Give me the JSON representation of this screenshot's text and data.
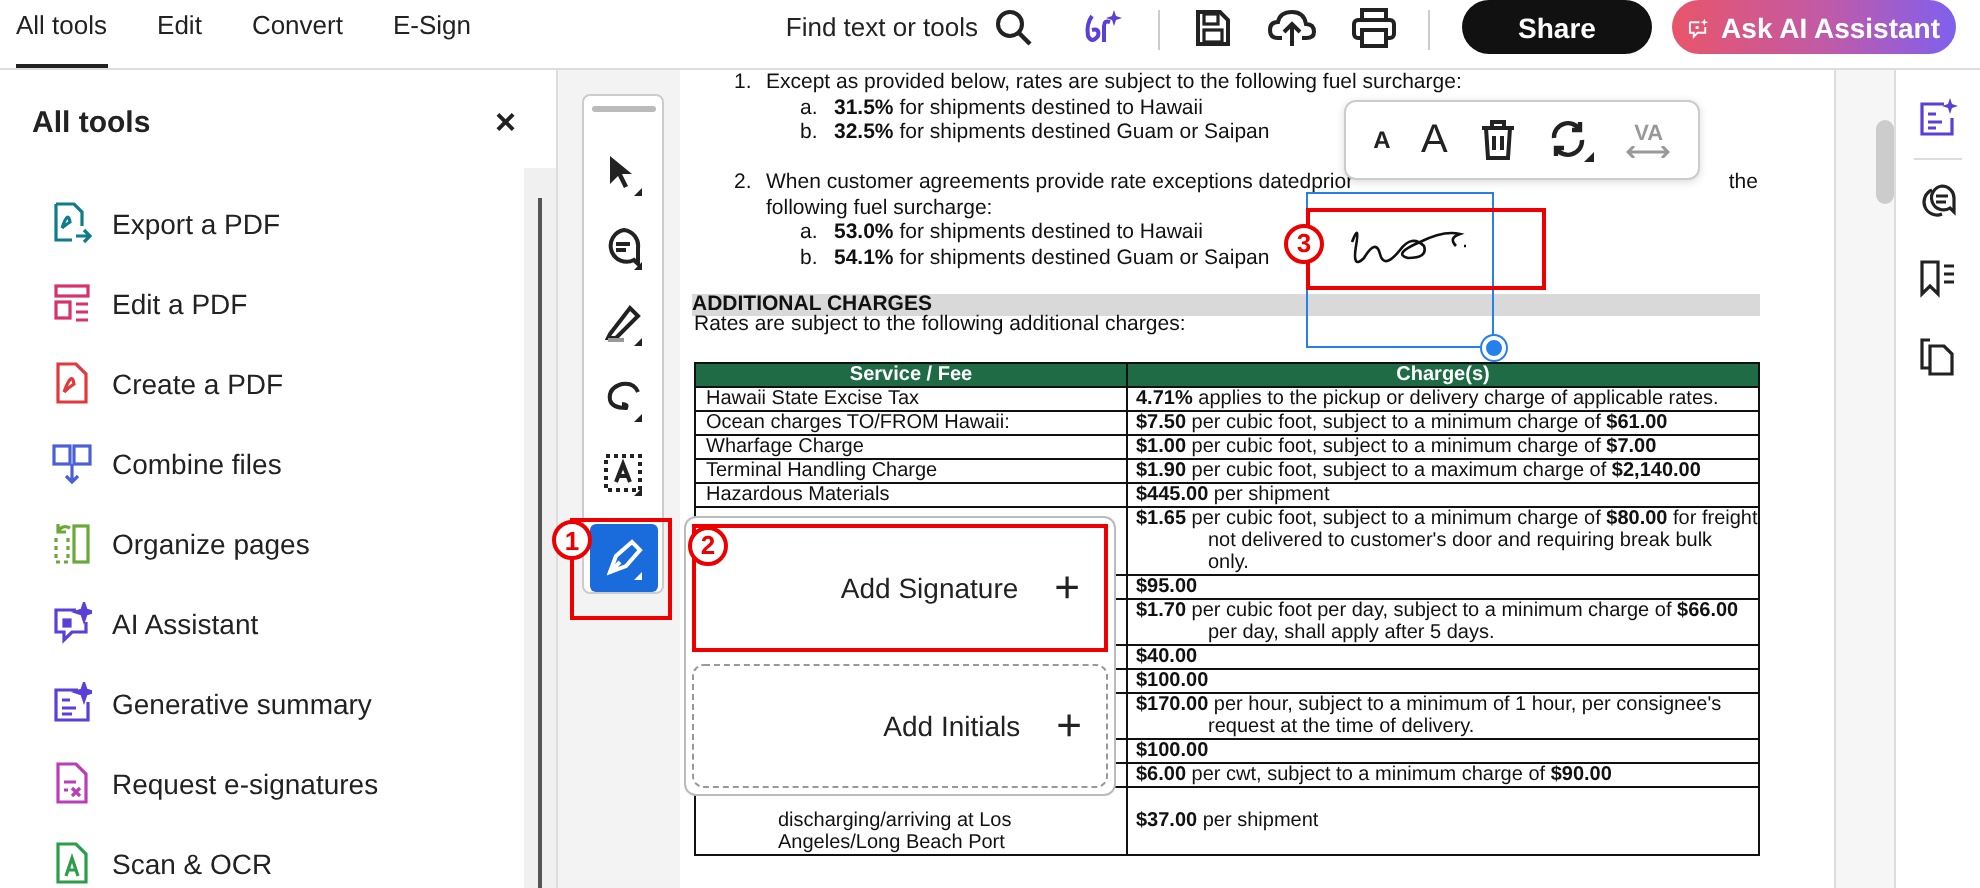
{
  "topbar": {
    "tabs": [
      {
        "label": "All tools",
        "selected": true
      },
      {
        "label": "Edit",
        "selected": false
      },
      {
        "label": "Convert",
        "selected": false
      },
      {
        "label": "E-Sign",
        "selected": false
      }
    ],
    "search": {
      "label": "Find text or tools"
    },
    "share": "Share",
    "ask_ai": "Ask AI Assistant"
  },
  "tools_panel": {
    "title": "All tools",
    "close": "×",
    "items": [
      {
        "kind": "export",
        "label": "Export a PDF"
      },
      {
        "kind": "edit",
        "label": "Edit a PDF"
      },
      {
        "kind": "create",
        "label": "Create a PDF"
      },
      {
        "kind": "combine",
        "label": "Combine files"
      },
      {
        "kind": "organize",
        "label": "Organize pages"
      },
      {
        "kind": "ai",
        "label": "AI Assistant"
      },
      {
        "kind": "summary",
        "label": "Generative summary"
      },
      {
        "kind": "request",
        "label": "Request e-signatures"
      },
      {
        "kind": "scan",
        "label": "Scan & OCR"
      }
    ]
  },
  "tool_rail": {
    "callout": "1",
    "tools": [
      {
        "kind": "select",
        "selected": false
      },
      {
        "kind": "comment",
        "selected": false
      },
      {
        "kind": "highlight",
        "selected": false
      },
      {
        "kind": "draw",
        "selected": false
      },
      {
        "kind": "text_select",
        "selected": false
      },
      {
        "kind": "sign",
        "selected": true
      }
    ]
  },
  "document": {
    "list": [
      {
        "number": "1.",
        "lines": [
          "Except as provided below, rates are subject to the following fuel surcharge:"
        ],
        "subitems": [
          {
            "letter": "a.",
            "text": "**31.5%** for shipments destined to Hawaii"
          },
          {
            "letter": "b.",
            "text": "**32.5%** for shipments destined Guam or Saipan"
          }
        ]
      },
      {
        "number": "2.",
        "lines": [
          "When customer agreements provide rate exceptions datedprior",
          "following fuel surcharge:"
        ],
        "line_end": "the",
        "subitems": [
          {
            "letter": "a.",
            "text": "**53.0%** for shipments destined to Hawaii"
          },
          {
            "letter": "b.",
            "text": "**54.1%** for shipments destined Guam or Saipan"
          }
        ]
      }
    ],
    "section": {
      "title": "ADDITIONAL CHARGES",
      "intro": "Rates are subject to the following additional charges:"
    },
    "table": {
      "columns": [
        "Service / Fee",
        "Charge(s)"
      ],
      "rows": [
        {
          "service": "Hawaii State Excise Tax",
          "charge": "**4.71%** applies to the pickup or delivery charge of applicable rates."
        },
        {
          "service": "Ocean charges TO/FROM Hawaii:",
          "charge": "**$7.50** per cubic foot, subject to a minimum charge of **$61.00**"
        },
        {
          "service": "Wharfage Charge",
          "charge": "**$1.00** per cubic foot, subject to a minimum charge of **$7.00**"
        },
        {
          "service": "Terminal Handling Charge",
          "charge": "**$1.90** per cubic foot, subject to a maximum charge of **$2,140.00**"
        },
        {
          "service": "Hazardous Materials",
          "charge": "**$445.00** per shipment"
        },
        {
          "charge": "**$1.65** per cubic foot, subject to a minimum charge of **$80.00** for freight not delivered to customer's door and requiring break bulk only."
        },
        {
          "charge": "**$95.00**"
        },
        {
          "charge": "**$1.70** per cubic foot per day, subject to a minimum charge of **$66.00** per day, shall apply after 5 days."
        },
        {
          "charge": "**$40.00**"
        },
        {
          "charge": "**$100.00**"
        },
        {
          "charge": "**$170.00** per hour, subject to a minimum of 1 hour, per consignee's request at the time of delivery."
        },
        {
          "charge": "**$100.00**"
        },
        {
          "charge": "**$6.00** per cwt, subject to a minimum charge of **$90.00**"
        },
        {
          "service": "discharging/arriving at Los Angeles/Long Beach Port",
          "charge": "**$37.00** per shipment"
        }
      ]
    }
  },
  "text_toolbar": {
    "buttons": [
      {
        "kind": "smaller",
        "label": "A",
        "disabled": false
      },
      {
        "kind": "larger",
        "label": "A",
        "disabled": false
      },
      {
        "kind": "delete",
        "disabled": false
      },
      {
        "kind": "replace",
        "disabled": false
      },
      {
        "kind": "kerning",
        "label": "VA",
        "disabled": true
      }
    ]
  },
  "signature": {
    "selected": true,
    "callout": "3"
  },
  "signature_menu": {
    "callout": "2",
    "options": [
      {
        "label": "Add Signature",
        "icon": "+",
        "highlighted": true
      },
      {
        "label": "Add Initials",
        "icon": "+",
        "highlighted": false
      }
    ]
  },
  "right_rail": {
    "tools": [
      {
        "kind": "summary"
      },
      {
        "kind": "comments"
      },
      {
        "kind": "bookmarks"
      },
      {
        "kind": "pages"
      }
    ]
  }
}
